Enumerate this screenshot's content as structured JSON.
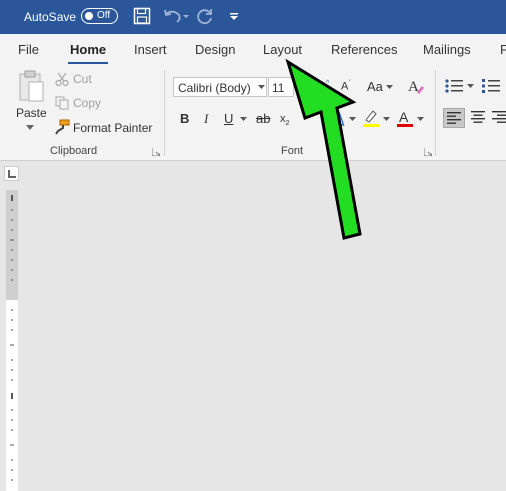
{
  "titlebar": {
    "autosave_label": "AutoSave",
    "autosave_state": "Off",
    "icons": [
      "save-icon",
      "undo-icon",
      "redo-icon",
      "customize-qat-icon"
    ]
  },
  "tabs": [
    {
      "label": "File"
    },
    {
      "label": "Home"
    },
    {
      "label": "Insert"
    },
    {
      "label": "Design"
    },
    {
      "label": "Layout"
    },
    {
      "label": "References"
    },
    {
      "label": "Mailings"
    },
    {
      "label": "F"
    }
  ],
  "clipboard": {
    "paste_label": "Paste",
    "cut_label": "Cut",
    "copy_label": "Copy",
    "format_painter_label": "Format Painter",
    "group_label": "Clipboard"
  },
  "font": {
    "font_name": "Calibri (Body)",
    "font_size": "11",
    "change_case_label": "Aa",
    "bold": "B",
    "italic": "I",
    "underline": "U",
    "strikethrough": "ab",
    "subscript": "x",
    "group_label": "Font"
  },
  "colors": {
    "titlebar": "#2b579a",
    "highlight": "#ffff00",
    "font_color": "#e00000",
    "arrow": "#22dd22"
  }
}
